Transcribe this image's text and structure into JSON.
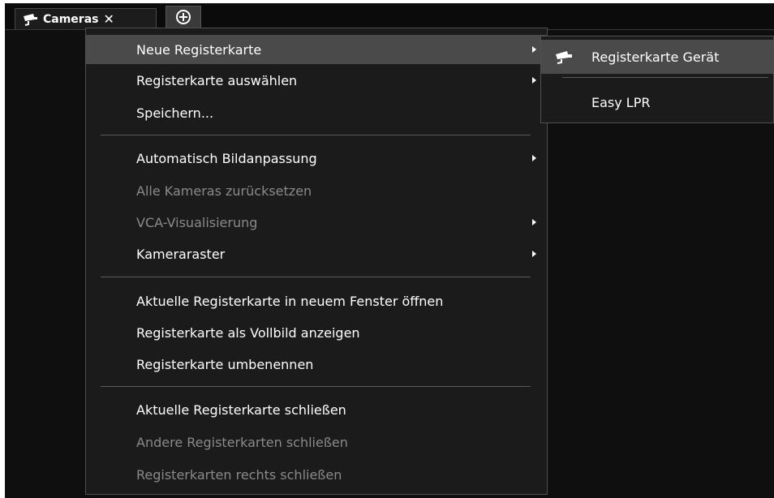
{
  "tab": {
    "label": "Cameras",
    "close_glyph": "✕",
    "icon": "camera-icon"
  },
  "add_tab": {
    "icon": "plus-circle-icon"
  },
  "menu": {
    "items": [
      {
        "label": "Neue Registerkarte",
        "submenu": true,
        "disabled": false,
        "highlighted": true
      },
      {
        "label": "Registerkarte auswählen",
        "submenu": true,
        "disabled": false
      },
      {
        "label": "Speichern...",
        "submenu": false,
        "disabled": false
      },
      {
        "label": "Automatisch Bildanpassung",
        "submenu": true,
        "disabled": false
      },
      {
        "label": "Alle Kameras zurücksetzen",
        "submenu": false,
        "disabled": true
      },
      {
        "label": "VCA-Visualisierung",
        "submenu": true,
        "disabled": true
      },
      {
        "label": "Kameraraster",
        "submenu": true,
        "disabled": false
      },
      {
        "label": "Aktuelle Registerkarte in neuem Fenster öffnen",
        "submenu": false,
        "disabled": false
      },
      {
        "label": "Registerkarte als Vollbild anzeigen",
        "submenu": false,
        "disabled": false
      },
      {
        "label": "Registerkarte umbenennen",
        "submenu": false,
        "disabled": false
      },
      {
        "label": "Aktuelle Registerkarte schließen",
        "submenu": false,
        "disabled": false
      },
      {
        "label": "Andere Registerkarten schließen",
        "submenu": false,
        "disabled": true
      },
      {
        "label": "Registerkarten rechts schließen",
        "submenu": false,
        "disabled": true
      }
    ]
  },
  "submenu": {
    "items": [
      {
        "label": "Registerkarte Gerät",
        "icon": "camera-icon",
        "highlighted": true
      },
      {
        "label": "Easy LPR"
      }
    ]
  },
  "colors": {
    "background": "#0f0f0f",
    "menu_bg": "#1b1b1b",
    "highlight": "#4a4a4a",
    "disabled_text": "#8a8a8a"
  }
}
